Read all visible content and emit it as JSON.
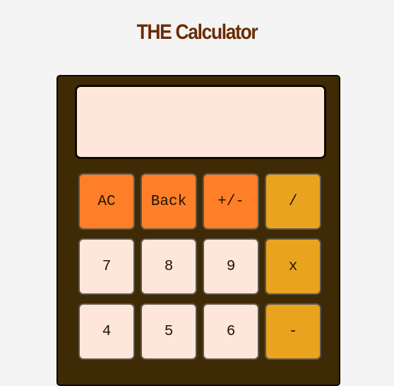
{
  "app": {
    "title": "THE Calculator"
  },
  "display": {
    "value": ""
  },
  "colors": {
    "background": "#f4f4f4",
    "body": "#3f2a06",
    "title": "#6a2c06",
    "display": "#ffe6da",
    "function_key": "#ff7f28",
    "operator_key": "#e9a31f",
    "number_key": "#ffe6da"
  },
  "keypad": {
    "rows": [
      [
        {
          "label": "AC",
          "kind": "fn"
        },
        {
          "label": "Back",
          "kind": "fn"
        },
        {
          "label": "+/-",
          "kind": "fn"
        },
        {
          "label": "/",
          "kind": "op"
        }
      ],
      [
        {
          "label": "7",
          "kind": "num"
        },
        {
          "label": "8",
          "kind": "num"
        },
        {
          "label": "9",
          "kind": "num"
        },
        {
          "label": "x",
          "kind": "op"
        }
      ],
      [
        {
          "label": "4",
          "kind": "num"
        },
        {
          "label": "5",
          "kind": "num"
        },
        {
          "label": "6",
          "kind": "num"
        },
        {
          "label": "-",
          "kind": "op"
        }
      ]
    ]
  }
}
